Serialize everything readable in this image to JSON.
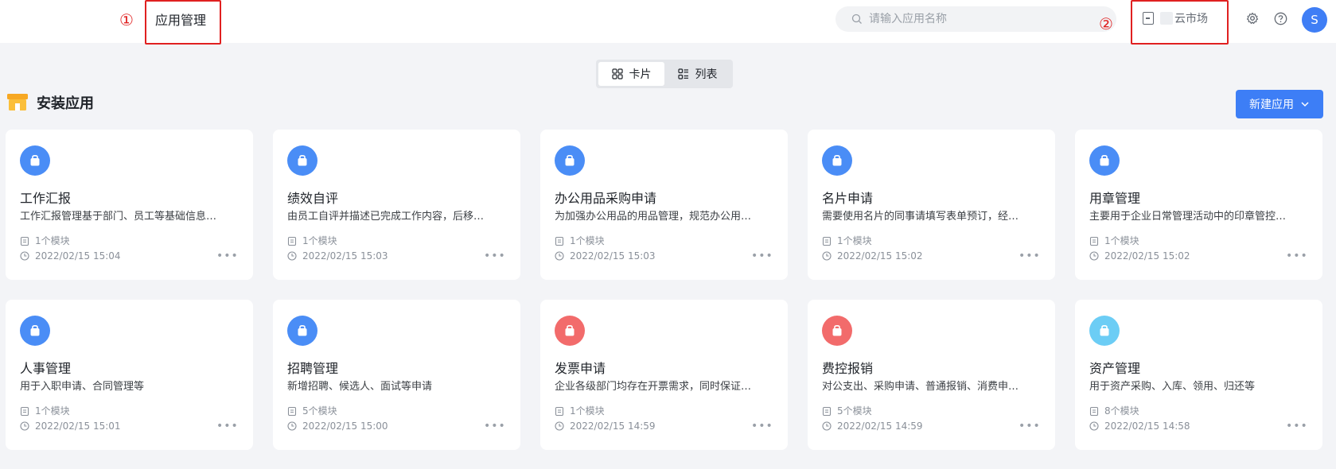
{
  "annotations": {
    "marker1": "①",
    "marker2": "②"
  },
  "header": {
    "title": "应用管理",
    "search_placeholder": "请输入应用名称",
    "market_label": "云市场",
    "avatar_initial": "S"
  },
  "view_toggle": {
    "card_label": "卡片",
    "list_label": "列表",
    "active": "卡片"
  },
  "section": {
    "title": "安装应用",
    "new_app_label": "新建应用"
  },
  "colors": {
    "accent": "#3d7ef6",
    "icon_blue": "#4a8df6",
    "icon_red": "#f26b6b",
    "icon_cyan": "#6ccdf5",
    "annotation_red": "#e02020"
  },
  "apps": [
    {
      "name": "工作汇报",
      "desc": "工作汇报管理基于部门、员工等基础信息…",
      "modules": "1个模块",
      "time": "2022/02/15 15:04",
      "icon_color": "blue"
    },
    {
      "name": "绩效自评",
      "desc": "由员工自评并描述已完成工作内容，后移…",
      "modules": "1个模块",
      "time": "2022/02/15 15:03",
      "icon_color": "blue"
    },
    {
      "name": "办公用品采购申请",
      "desc": "为加强办公用品的用品管理，规范办公用…",
      "modules": "1个模块",
      "time": "2022/02/15 15:03",
      "icon_color": "blue"
    },
    {
      "name": "名片申请",
      "desc": "需要使用名片的同事请填写表单预订，经…",
      "modules": "1个模块",
      "time": "2022/02/15 15:02",
      "icon_color": "blue"
    },
    {
      "name": "用章管理",
      "desc": "主要用于企业日常管理活动中的印章管控…",
      "modules": "1个模块",
      "time": "2022/02/15 15:02",
      "icon_color": "blue"
    },
    {
      "name": "人事管理",
      "desc": "用于入职申请、合同管理等",
      "modules": "1个模块",
      "time": "2022/02/15 15:01",
      "icon_color": "blue"
    },
    {
      "name": "招聘管理",
      "desc": "新增招聘、候选人、面试等申请",
      "modules": "5个模块",
      "time": "2022/02/15 15:00",
      "icon_color": "blue"
    },
    {
      "name": "发票申请",
      "desc": "企业各级部门均存在开票需求，同时保证…",
      "modules": "1个模块",
      "time": "2022/02/15 14:59",
      "icon_color": "red"
    },
    {
      "name": "费控报销",
      "desc": "对公支出、采购申请、普通报销、消费申…",
      "modules": "5个模块",
      "time": "2022/02/15 14:59",
      "icon_color": "red"
    },
    {
      "name": "资产管理",
      "desc": "用于资产采购、入库、领用、归还等",
      "modules": "8个模块",
      "time": "2022/02/15 14:58",
      "icon_color": "cyan"
    }
  ]
}
